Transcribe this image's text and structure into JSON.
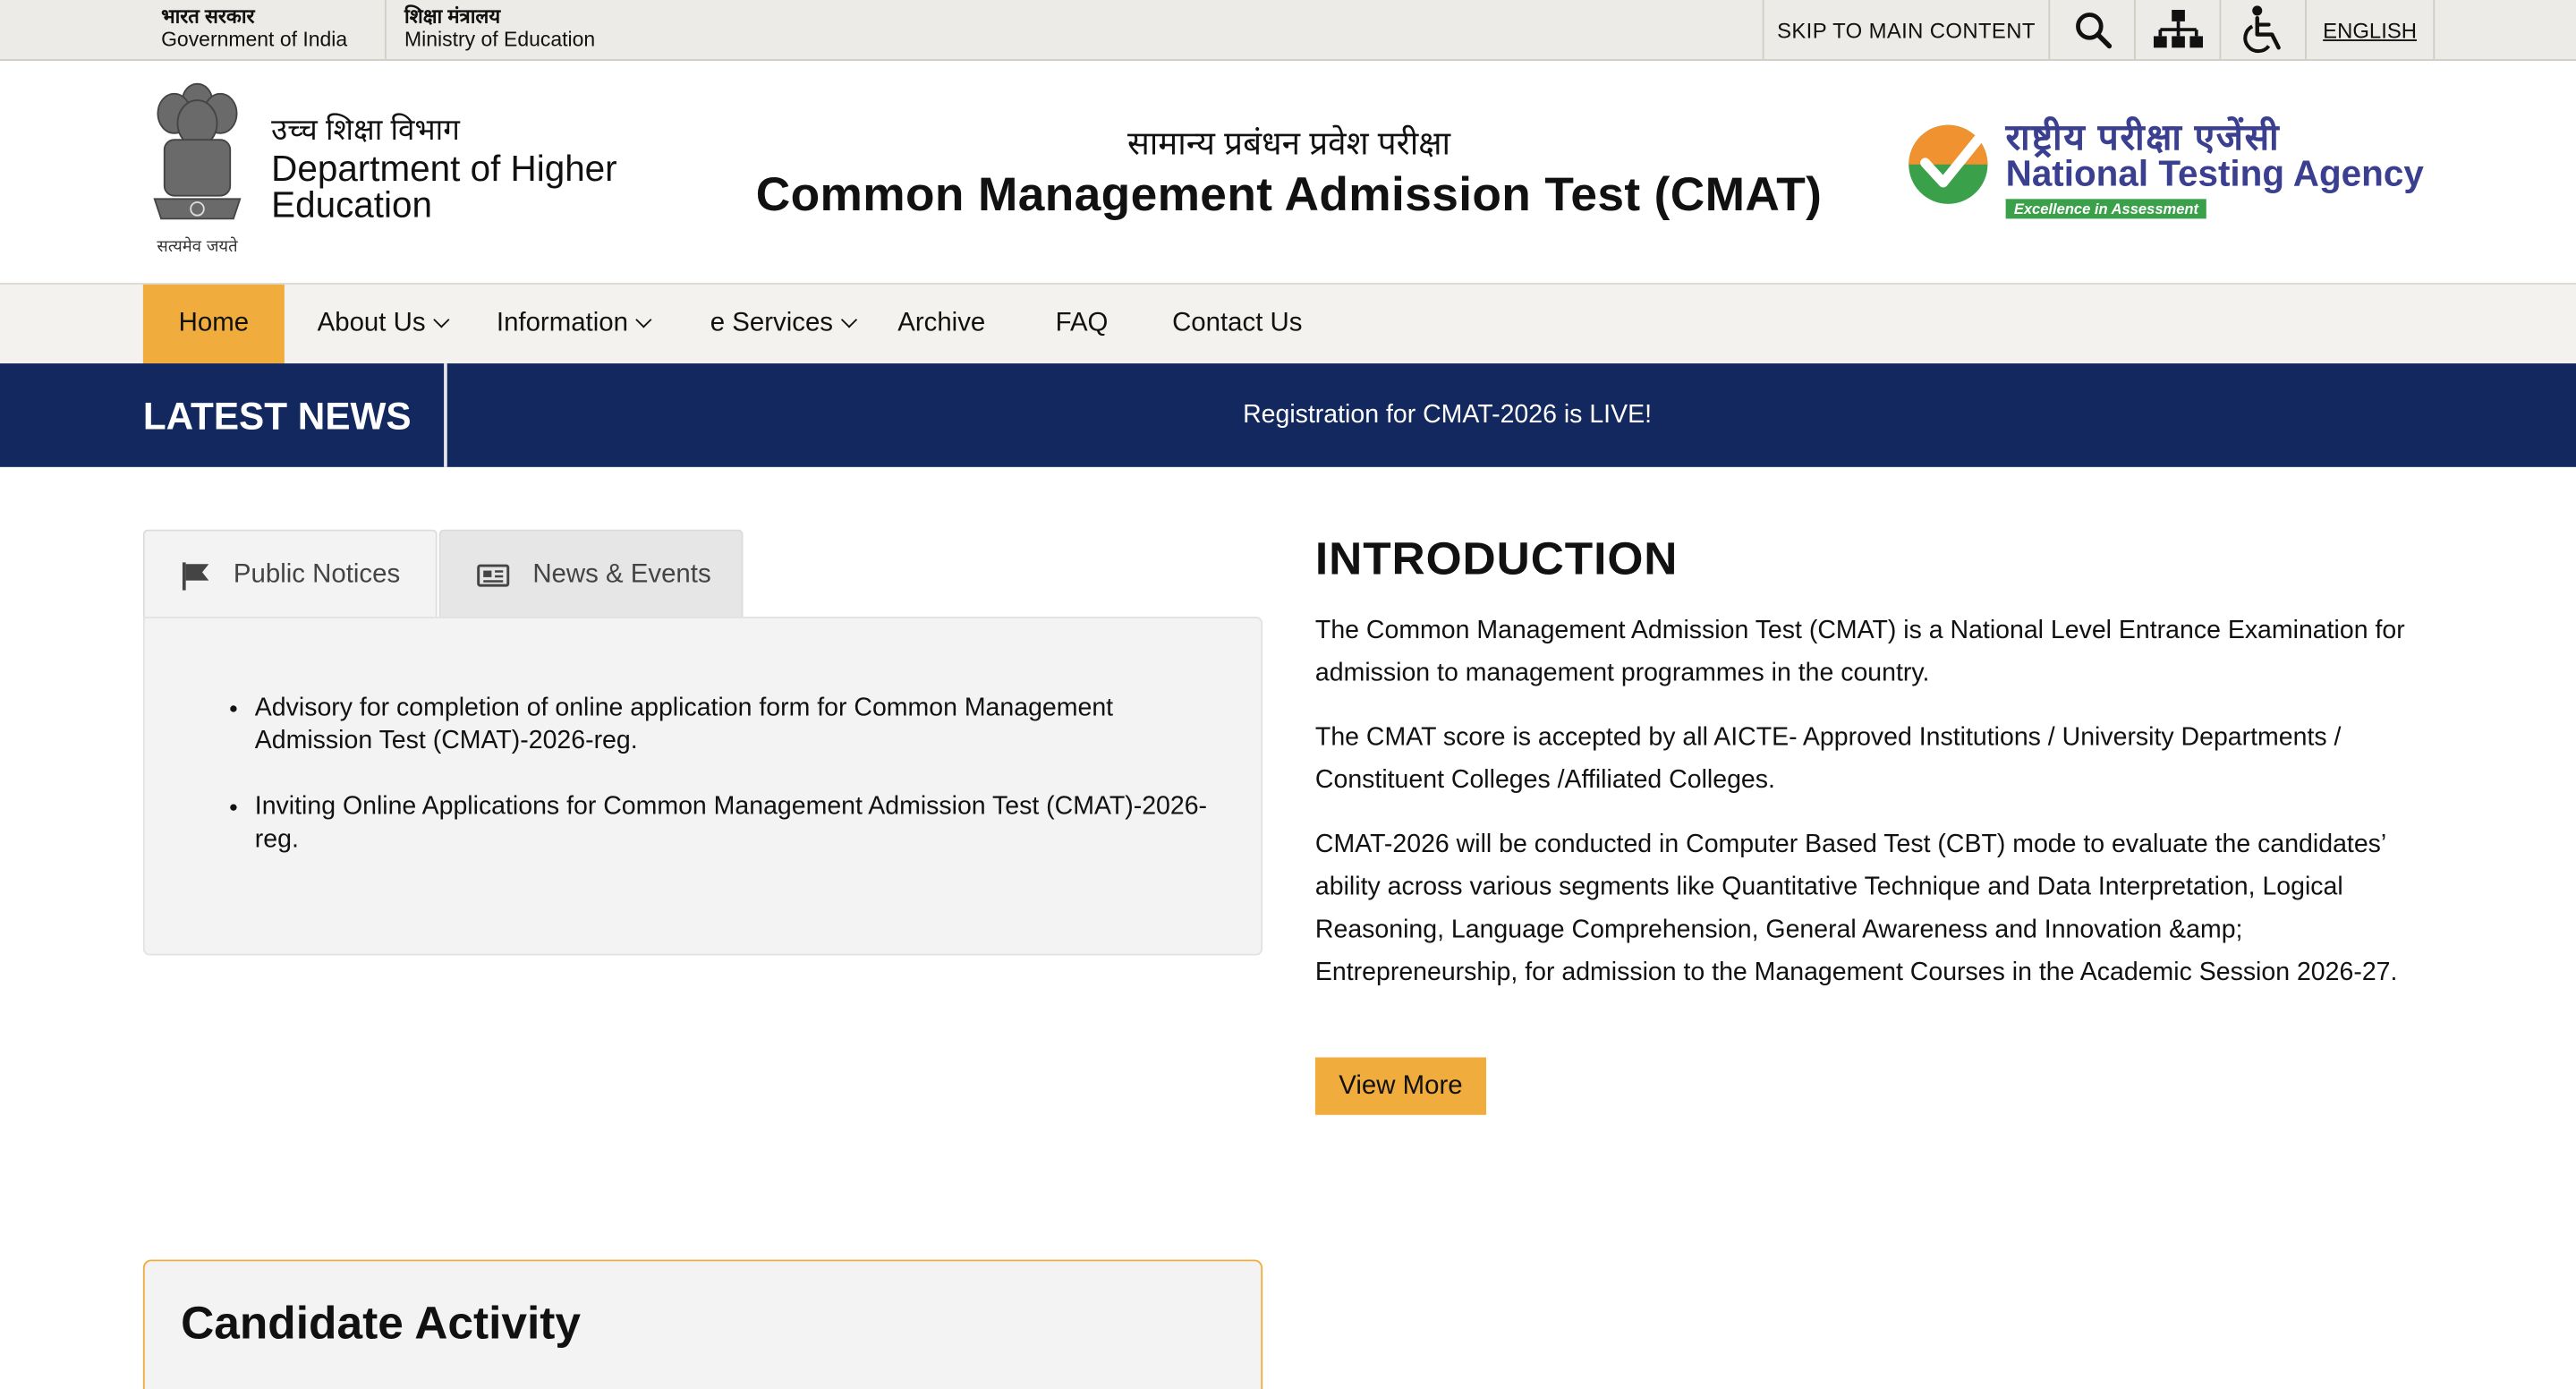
{
  "gov_bar": {
    "gov_india_hi": "भारत सरकार",
    "gov_india_en": "Government of India",
    "ministry_hi": "शिक्षा मंत्रालय",
    "ministry_en": "Ministry of Education",
    "skip_label": "SKIP TO MAIN CONTENT",
    "language_label": "ENGLISH",
    "icons": [
      "search-icon",
      "sitemap-icon",
      "accessibility-icon"
    ]
  },
  "header": {
    "emblem_motto": "सत्यमेव जयते",
    "dept_hi": "उच्च शिक्षा विभाग",
    "dept_en": "Department of Higher Education",
    "title_hi": "सामान्य प्रबंधन प्रवेश परीक्षा",
    "title_en": "Common Management Admission Test (CMAT)",
    "nta_hi": "राष्ट्रीय परीक्षा एजेंसी",
    "nta_en": "National Testing Agency",
    "nta_tagline": "Excellence in Assessment"
  },
  "nav": {
    "items": [
      {
        "label": "Home"
      },
      {
        "label": "About Us"
      },
      {
        "label": "Information"
      },
      {
        "label": "e Services"
      },
      {
        "label": "Archive"
      },
      {
        "label": "FAQ"
      },
      {
        "label": "Contact Us"
      }
    ]
  },
  "latest_news": {
    "label": "LATEST NEWS",
    "text": "Registration for CMAT-2026 is LIVE!"
  },
  "tabs": {
    "items": [
      {
        "label": "Public Notices"
      },
      {
        "label": "News & Events"
      }
    ],
    "notices": [
      "Advisory for completion of online application form for Common Management Admission Test (CMAT)-2026-reg.",
      "Inviting Online Applications for Common Management Admission Test (CMAT)-2026-reg."
    ]
  },
  "intro": {
    "heading": "INTRODUCTION",
    "paragraphs": [
      "The Common Management Admission Test (CMAT) is a National Level Entrance Examination for admission to management programmes in the country.",
      "The CMAT score is accepted by all AICTE- Approved Institutions / University Departments / Constituent Colleges /Affiliated Colleges.",
      "CMAT-2026 will be conducted in Computer Based Test (CBT) mode to evaluate the candidates’ ability across various segments like Quantitative Technique and Data Interpretation, Logical Reasoning, Language Comprehension, General Awareness and Innovation &amp; Entrepreneurship, for admission to the Management Courses in the Academic Session 2026-27."
    ],
    "view_more_label": "View More"
  },
  "candidate_activity": {
    "heading": "Candidate Activity"
  },
  "colors": {
    "accent": "#f0ad3e",
    "news_bar": "#12285e",
    "nta_blue": "#3b3f8f",
    "nta_green": "#3aa04a"
  }
}
